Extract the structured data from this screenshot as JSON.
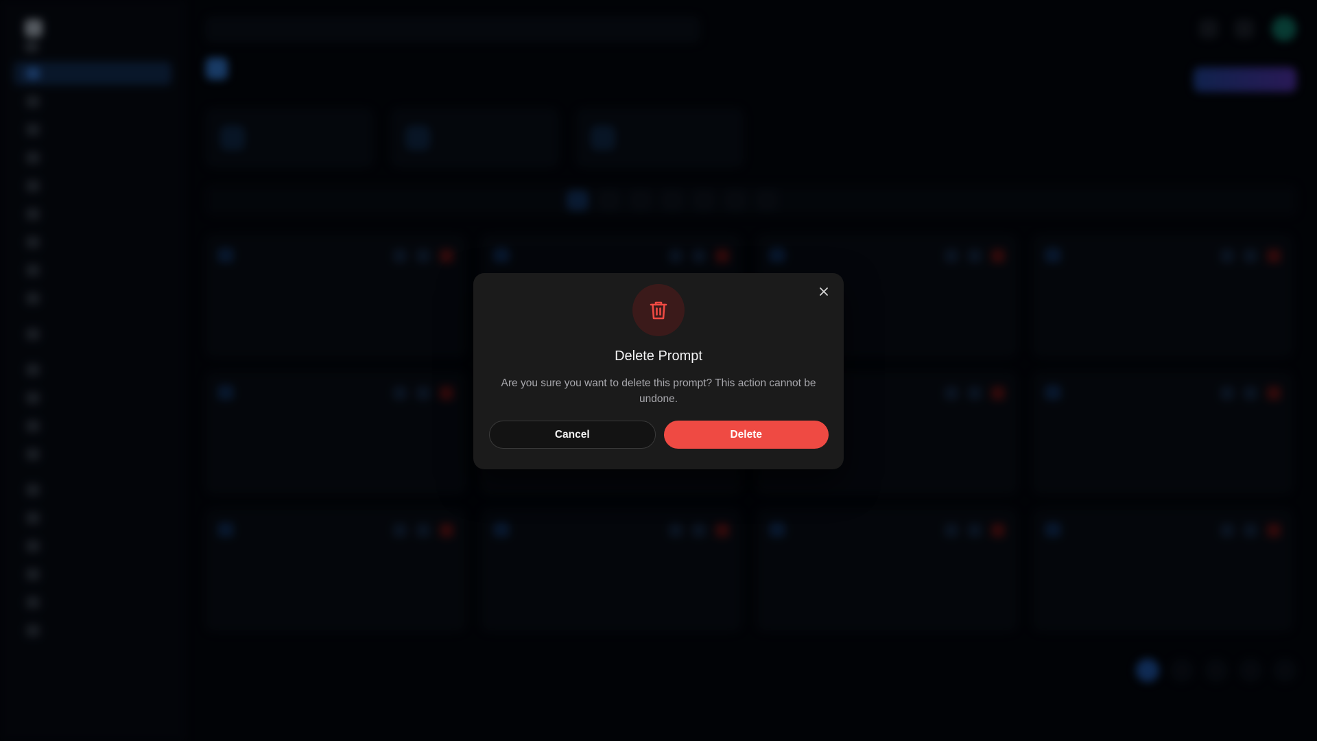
{
  "modal": {
    "title": "Delete Prompt",
    "message": "Are you sure you want to delete this prompt? This action cannot be undone.",
    "cancel_label": "Cancel",
    "delete_label": "Delete",
    "close_icon": "close-icon",
    "header_icon": "trash-icon"
  },
  "colors": {
    "danger": "#ef4a43",
    "modal_bg": "#1b1b1b",
    "accent": "#2f66b3"
  }
}
